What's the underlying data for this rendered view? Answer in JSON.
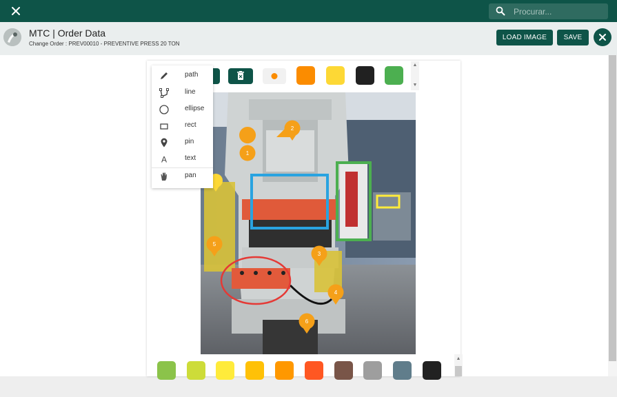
{
  "topbar": {
    "close_icon": "close-icon",
    "search_placeholder": "Procurar..."
  },
  "header": {
    "title": "MTC | Order Data",
    "subtitle_prefix": "Change Order :",
    "subtitle_value": "PREV00010 - PREVENTIVE PRESS 20 TON",
    "load_image_label": "LOAD IMAGE",
    "save_label": "SAVE"
  },
  "toolbar": {
    "accent": "#0e5448",
    "swatches": [
      "#fb8c00",
      "#fdd835",
      "#212121",
      "#4caf50"
    ],
    "dot_color": "#fb8c00"
  },
  "draw_menu": {
    "items": [
      {
        "label": "path",
        "icon": "pencil-icon"
      },
      {
        "label": "line",
        "icon": "polyline-icon"
      },
      {
        "label": "ellipse",
        "icon": "ellipse-icon"
      },
      {
        "label": "rect",
        "icon": "rectangle-icon"
      },
      {
        "label": "pin",
        "icon": "pin-icon"
      },
      {
        "label": "text",
        "icon": "text-icon"
      },
      {
        "label": "pan",
        "icon": "hand-icon"
      }
    ]
  },
  "palette": {
    "colors": [
      "#8bc34a",
      "#cddc39",
      "#ffeb3b",
      "#ffc107",
      "#ff9800",
      "#ff5722",
      "#795548",
      "#9e9e9e",
      "#607d8b",
      "#212121"
    ]
  },
  "annotations": {
    "pins": [
      "1",
      "2",
      "3",
      "4",
      "5",
      "6"
    ],
    "shapes": [
      {
        "type": "rect",
        "color": "#29a3e0"
      },
      {
        "type": "rect",
        "color": "#4caf50"
      },
      {
        "type": "rect",
        "color": "#ffeb3b"
      },
      {
        "type": "ellipse",
        "color": "#e53935"
      }
    ]
  }
}
